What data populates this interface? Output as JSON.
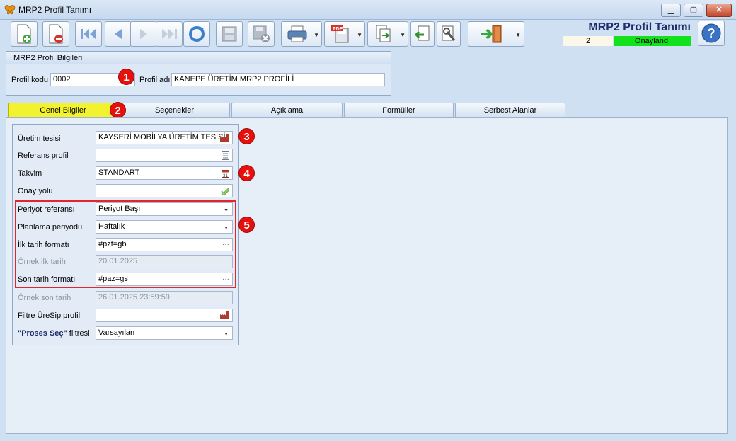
{
  "window": {
    "title": "MRP2 Profil Tanımı",
    "minimize": "▁",
    "maximize": "▢",
    "close": "✕"
  },
  "toolbar": {
    "buttons": [
      {
        "name": "new-document-button",
        "icon": "new-doc-icon"
      },
      {
        "name": "delete-document-button",
        "icon": "delete-doc-icon"
      },
      {
        "name": "first-record-button",
        "icon": "first-icon"
      },
      {
        "name": "previous-record-button",
        "icon": "previous-icon"
      },
      {
        "name": "next-record-button",
        "icon": "next-icon"
      },
      {
        "name": "last-record-button",
        "icon": "last-icon"
      },
      {
        "name": "refresh-button",
        "icon": "refresh-icon"
      },
      {
        "name": "save-button",
        "icon": "save-icon"
      },
      {
        "name": "save-close-button",
        "icon": "save-close-icon"
      },
      {
        "name": "print-button",
        "icon": "printer-icon"
      },
      {
        "name": "pdf-button",
        "icon": "pdf-icon",
        "pdf_label": "PDF"
      },
      {
        "name": "export-button",
        "icon": "export-icon"
      },
      {
        "name": "import-button",
        "icon": "import-icon"
      },
      {
        "name": "tools-button",
        "icon": "wrench-icon"
      },
      {
        "name": "exit-button",
        "icon": "exit-door-icon"
      }
    ]
  },
  "header": {
    "doc_title": "MRP2 Profil Tanımı",
    "doc_number": "2",
    "status": "Onaylandı",
    "status_color": "#12e21a"
  },
  "profile_group": {
    "title": "MRP2 Profil Bilgileri",
    "code_label": "Profil kodu",
    "code_value": "0002",
    "name_label": "Profil adı",
    "name_value": "KANEPE ÜRETİM MRP2 PROFİLİ"
  },
  "tabs": [
    "Genel Bilgiler",
    "Seçenekler",
    "Açıklama",
    "Formüller",
    "Serbest Alanlar"
  ],
  "general": {
    "uretim_tesisi_label": "Üretim tesisi",
    "uretim_tesisi_value": "KAYSERİ MOBİLYA ÜRETİM TESİSİ",
    "referans_profil_label": "Referans profil",
    "referans_profil_value": "",
    "takvim_label": "Takvim",
    "takvim_value": "STANDART",
    "onay_yolu_label": "Onay yolu",
    "onay_yolu_value": "",
    "periyot_referansi_label": "Periyot referansı",
    "periyot_referansi_value": "Periyot Başı",
    "planlama_periyodu_label": "Planlama periyodu",
    "planlama_periyodu_value": "Haftalık",
    "ilk_tarih_formati_label": "İlk tarih formatı",
    "ilk_tarih_formati_value": "#pzt=gb",
    "ornek_ilk_tarih_label": "Örnek ilk tarih",
    "ornek_ilk_tarih_value": "20.01.2025",
    "son_tarih_formati_label": "Son tarih formatı",
    "son_tarih_formati_value": "#paz=gs",
    "ornek_son_tarih_label": "Örnek son tarih",
    "ornek_son_tarih_value": "26.01.2025 23:59:59",
    "filtre_label": "Filtre ÜreSip profil",
    "filtre_value": "",
    "proses_label_bold": "\"Proses Seç\"",
    "proses_label_rest": " filtresi",
    "proses_value": "Varsayılan"
  },
  "markers": [
    "1",
    "2",
    "3",
    "4",
    "5"
  ],
  "ellipsis": "···"
}
